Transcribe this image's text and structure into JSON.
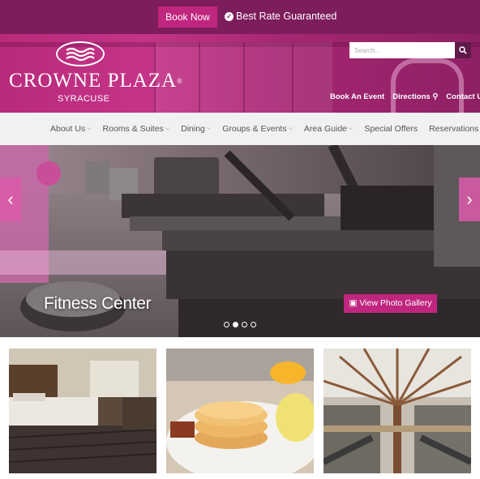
{
  "topbar": {
    "book_now_label": "Book Now",
    "best_rate_label": "Best Rate Guaranteed"
  },
  "brand": {
    "name": "CROWNE PLAZA",
    "registered_mark": "®",
    "city": "SYRACUSE"
  },
  "search": {
    "placeholder": "Search..."
  },
  "utility_links": [
    {
      "label": "Book An Event"
    },
    {
      "label": "Directions",
      "icon": "map-marker-icon"
    },
    {
      "label": "Contact Us",
      "icon": "envelope-icon"
    }
  ],
  "nav": {
    "items": [
      {
        "label": "About Us",
        "dropdown": true
      },
      {
        "label": "Rooms & Suites",
        "dropdown": true
      },
      {
        "label": "Dining",
        "dropdown": true
      },
      {
        "label": "Groups & Events",
        "dropdown": true
      },
      {
        "label": "Area Guide",
        "dropdown": true
      },
      {
        "label": "Special Offers",
        "dropdown": false
      },
      {
        "label": "Reservations",
        "dropdown": false
      }
    ]
  },
  "slider": {
    "caption": "Fitness Center",
    "gallery_button_label": "View Photo Gallery",
    "prev_glyph": "‹",
    "next_glyph": "›",
    "total_slides": 4,
    "active_slide": 2
  },
  "colors": {
    "brand_dark": "#7d1d5b",
    "brand_accent": "#c0267f",
    "nav_bg": "#f0f0f0"
  },
  "thumbnails": [
    {
      "subject": "hotel-room"
    },
    {
      "subject": "pancake-breakfast"
    },
    {
      "subject": "shopping-mall-atrium"
    }
  ]
}
